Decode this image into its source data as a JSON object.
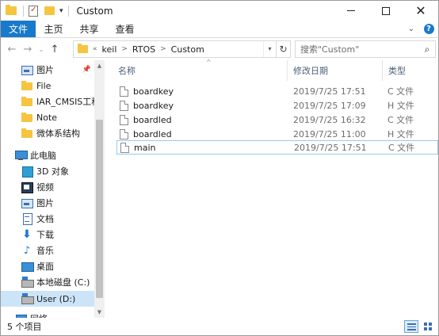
{
  "window": {
    "title": "Custom",
    "controls": {
      "minimize": "minimize",
      "maximize": "maximize",
      "close": "✕"
    }
  },
  "ribbon": {
    "tabs": [
      {
        "label": "文件",
        "active": true
      },
      {
        "label": "主页",
        "active": false
      },
      {
        "label": "共享",
        "active": false
      },
      {
        "label": "查看",
        "active": false
      }
    ],
    "help_label": "?"
  },
  "nav": {
    "back": "←",
    "forward": "→",
    "recent": "⌄",
    "up": "↑",
    "breadcrumb_overflow": "«",
    "breadcrumb": [
      "keil",
      "RTOS",
      "Custom"
    ],
    "refresh": "↻",
    "search": {
      "placeholder": "搜索\"Custom\"",
      "value": ""
    }
  },
  "sidebar": {
    "items": [
      {
        "label": "图片",
        "icon": "picture-icon",
        "pinned": true
      },
      {
        "label": "File",
        "icon": "folder-icon"
      },
      {
        "label": "IAR_CMSIS工程",
        "icon": "folder-icon"
      },
      {
        "label": "Note",
        "icon": "folder-icon"
      },
      {
        "label": "微体系结构",
        "icon": "folder-icon"
      },
      {
        "label": "此电脑",
        "icon": "computer-icon"
      },
      {
        "label": "3D 对象",
        "icon": "3d-objects-icon"
      },
      {
        "label": "视频",
        "icon": "video-icon"
      },
      {
        "label": "图片",
        "icon": "picture-icon"
      },
      {
        "label": "文档",
        "icon": "document-icon"
      },
      {
        "label": "下载",
        "icon": "download-icon"
      },
      {
        "label": "音乐",
        "icon": "music-icon"
      },
      {
        "label": "桌面",
        "icon": "desktop-icon"
      },
      {
        "label": "本地磁盘 (C:)",
        "icon": "drive-icon"
      },
      {
        "label": "User (D:)",
        "icon": "drive-icon",
        "selected": true
      },
      {
        "label": "网络",
        "icon": "network-icon"
      }
    ]
  },
  "filelist": {
    "columns": {
      "name": "名称",
      "date": "修改日期",
      "type": "类型"
    },
    "files": [
      {
        "name": "boardkey",
        "date": "2019/7/25 17:51",
        "type": "C 文件"
      },
      {
        "name": "boardkey",
        "date": "2019/7/25 17:09",
        "type": "H 文件"
      },
      {
        "name": "boardled",
        "date": "2019/7/25 16:32",
        "type": "C 文件"
      },
      {
        "name": "boardled",
        "date": "2019/7/25 11:00",
        "type": "H 文件"
      },
      {
        "name": "main",
        "date": "2019/7/25 17:51",
        "type": "C 文件",
        "focused": true
      }
    ]
  },
  "status": {
    "item_count": "5 个项目"
  },
  "colors": {
    "accent": "#1979ca",
    "selection": "#cce4f7",
    "folder": "#f5c540"
  }
}
